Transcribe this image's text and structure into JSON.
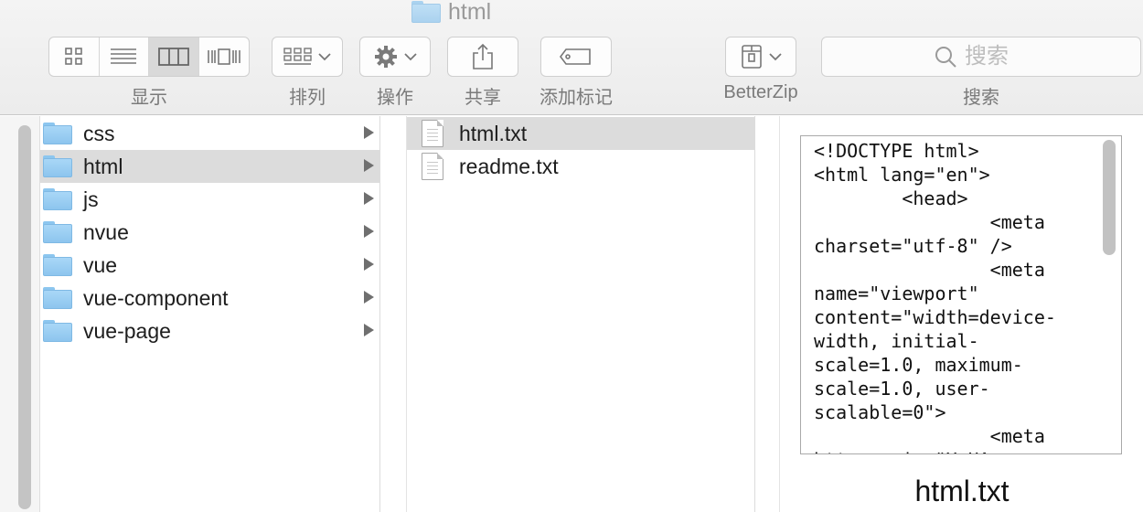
{
  "window": {
    "title": "html"
  },
  "toolbar": {
    "view_label": "显示",
    "sort_label": "排列",
    "action_label": "操作",
    "share_label": "共享",
    "tag_label": "添加标记",
    "betterzip_label": "BetterZip",
    "search_label": "搜索",
    "search_placeholder": "搜索",
    "active_view": "columns"
  },
  "column1": {
    "items": [
      {
        "label": "css",
        "type": "folder",
        "selected": false
      },
      {
        "label": "html",
        "type": "folder",
        "selected": true
      },
      {
        "label": "js",
        "type": "folder",
        "selected": false
      },
      {
        "label": "nvue",
        "type": "folder",
        "selected": false
      },
      {
        "label": "vue",
        "type": "folder",
        "selected": false
      },
      {
        "label": "vue-component",
        "type": "folder",
        "selected": false
      },
      {
        "label": "vue-page",
        "type": "folder",
        "selected": false
      }
    ]
  },
  "column2": {
    "items": [
      {
        "label": "html.txt",
        "type": "file",
        "selected": true
      },
      {
        "label": "readme.txt",
        "type": "file",
        "selected": false
      }
    ]
  },
  "preview": {
    "content": "<!DOCTYPE html>\n<html lang=\"en\">\n        <head>\n                <meta\ncharset=\"utf-8\" />\n                <meta\nname=\"viewport\"\ncontent=\"width=device-\nwidth, initial-\nscale=1.0, maximum-\nscale=1.0, user-\nscalable=0\">\n                <meta\nhttp-equiv=\"X-UA-",
    "file_name": "html.txt"
  },
  "colors": {
    "folder": "#8dc5ee",
    "selection": "#dcdcdc",
    "toolbar": "#ececec"
  }
}
